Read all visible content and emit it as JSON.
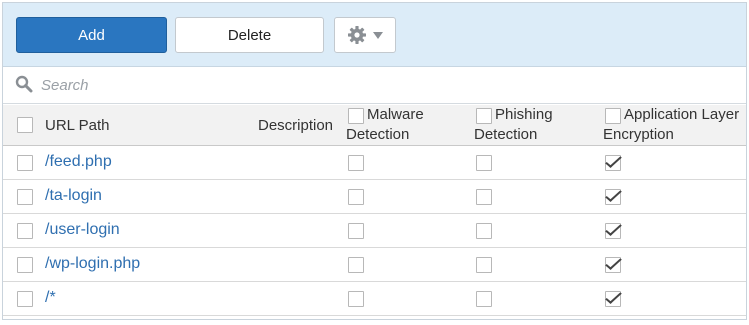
{
  "toolbar": {
    "add_label": "Add",
    "delete_label": "Delete",
    "settings_icon": "gear-icon",
    "dropdown_icon": "caret-down-icon"
  },
  "search": {
    "placeholder": "Search",
    "value": ""
  },
  "table": {
    "columns": {
      "url_path": "URL Path",
      "description": "Description",
      "malware": "Malware Detection",
      "phishing": "Phishing Detection",
      "encryption": "Application Layer Encryption"
    },
    "header_lines": {
      "malware_1": "Malware",
      "malware_2": "Detection",
      "phishing_1": "Phishing",
      "phishing_2": "Detection",
      "encryption_1": "Application Layer",
      "encryption_2": "Encryption"
    },
    "rows": [
      {
        "url_path": "/feed.php",
        "description": "",
        "malware": false,
        "phishing": false,
        "encryption": true
      },
      {
        "url_path": "/ta-login",
        "description": "",
        "malware": false,
        "phishing": false,
        "encryption": true
      },
      {
        "url_path": "/user-login",
        "description": "",
        "malware": false,
        "phishing": false,
        "encryption": true
      },
      {
        "url_path": "/wp-login.php",
        "description": "",
        "malware": false,
        "phishing": false,
        "encryption": true
      },
      {
        "url_path": "/*",
        "description": "",
        "malware": false,
        "phishing": false,
        "encryption": true
      }
    ]
  },
  "colors": {
    "accent": "#2a76c0",
    "toolbar_bg": "#dcecf8",
    "link": "#2f6fb0"
  }
}
